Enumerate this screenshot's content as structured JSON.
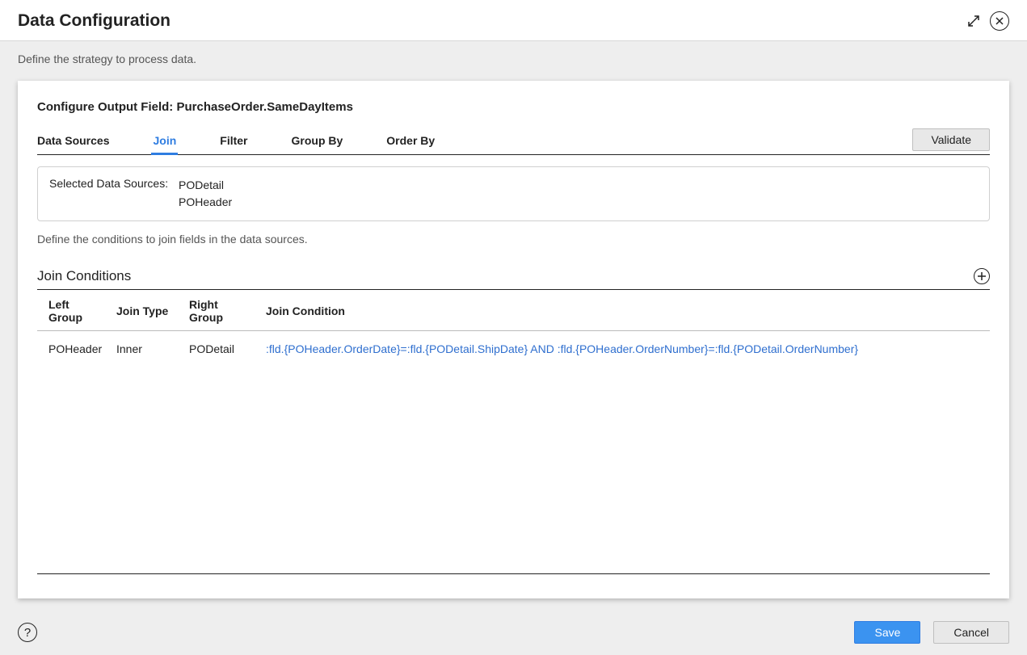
{
  "header": {
    "title": "Data Configuration"
  },
  "subheader": "Define the strategy to process data.",
  "panel": {
    "title_prefix": "Configure Output Field: ",
    "output_field": "PurchaseOrder.SameDayItems",
    "tabs": {
      "data_sources": "Data Sources",
      "join": "Join",
      "filter": "Filter",
      "group_by": "Group By",
      "order_by": "Order By",
      "active": "join"
    },
    "validate_label": "Validate",
    "selected_sources_label": "Selected Data Sources:",
    "selected_sources": [
      "PODetail",
      "POHeader"
    ],
    "join_instructions": "Define the conditions to join fields in the data sources.",
    "join_conditions_title": "Join Conditions",
    "columns": {
      "left_group": "Left Group",
      "join_type": "Join Type",
      "right_group": "Right Group",
      "join_condition": "Join Condition"
    },
    "rows": [
      {
        "left_group": "POHeader",
        "join_type": "Inner",
        "right_group": "PODetail",
        "condition": ":fld.{POHeader.OrderDate}=:fld.{PODetail.ShipDate} AND :fld.{POHeader.OrderNumber}=:fld.{PODetail.OrderNumber}"
      }
    ]
  },
  "footer": {
    "save_label": "Save",
    "cancel_label": "Cancel"
  }
}
